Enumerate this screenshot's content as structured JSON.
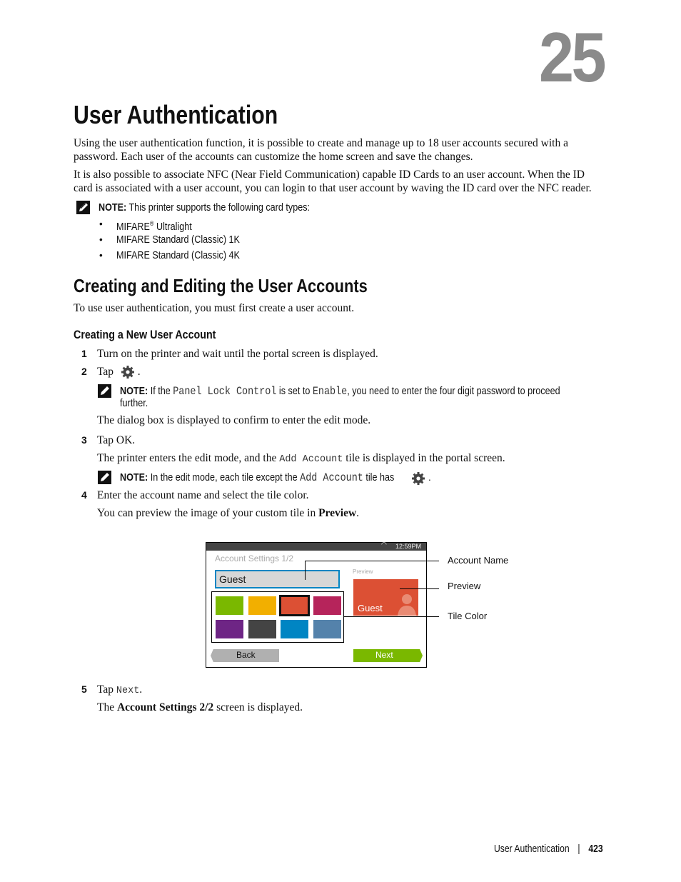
{
  "chapter_number": "25",
  "title": "User Authentication",
  "intro": {
    "p1": [
      "Using the user authentication function, it is possible to create and manage up to 18 user accounts secured with a",
      "password. Each user of the accounts can customize the home screen and save the changes."
    ],
    "p2": [
      "It is also possible to associate NFC (Near Field Communication) capable ID Cards to an user account. When the ID",
      "card is associated with a user account, you can login to that user account by waving the ID card over the NFC reader."
    ]
  },
  "note1": {
    "label": "NOTE:",
    "text": "This printer supports the following card types:",
    "items": [
      {
        "text": "MIFARE",
        "sup": "®",
        "rest": " Ultralight"
      },
      {
        "text": "MIFARE Standard (Classic) 1K"
      },
      {
        "text": "MIFARE Standard (Classic) 4K"
      }
    ]
  },
  "section": {
    "title": "Creating and Editing the User Accounts",
    "intro": "To use user authentication, you must first create a user account."
  },
  "subsection": {
    "title": "Creating a New User Account"
  },
  "steps": [
    {
      "num": "1",
      "text": "Turn on the printer and wait until the portal screen is displayed."
    },
    {
      "num": "2",
      "text": "Tap",
      "after": ".",
      "icon": "gear-icon",
      "note": {
        "label": "NOTE:",
        "pre": "If the",
        "code1": "Panel Lock Control",
        "mid": "is set to",
        "code2": "Enable",
        "post": ", you need to enter the four digit password to proceed",
        "line2": "further."
      },
      "follow": "The dialog box is displayed to confirm to enter the edit mode."
    },
    {
      "num": "3",
      "text": "Tap",
      "bold": "OK",
      "after": ".",
      "follow_pre": "The printer enters the edit mode, and the",
      "follow_code": "Add Account",
      "follow_post": "tile is displayed in the portal screen.",
      "note": {
        "label": "NOTE:",
        "pre": "In the edit mode, each tile except the",
        "code": "Add Account",
        "post": "tile has",
        "after": "."
      }
    },
    {
      "num": "4",
      "text": "Enter the account name and select the tile color.",
      "follow_pre": "You can preview the image of your custom tile in",
      "follow_bold": "Preview",
      "follow_post": "."
    },
    {
      "num": "5",
      "text": "Tap",
      "code": "Next",
      "after": ".",
      "follow_pre": "The",
      "follow_bold": "Account Settings 2/2",
      "follow_post": "screen is displayed."
    }
  ],
  "figure": {
    "time": "12:59PM",
    "screen_title": "Account Settings 1/2",
    "name_value": "Guest",
    "preview_label": "Preview",
    "preview_name": "Guest",
    "colors": [
      "#7ab800",
      "#f2af00",
      "#dc5034",
      "#b6245b",
      "#6e2585",
      "#444444",
      "#0085c3",
      "#5482ab"
    ],
    "selected_color_index": 2,
    "back": "Back",
    "next": "Next",
    "callouts": [
      "Account Name",
      "Preview",
      "Tile Color"
    ]
  },
  "footer": {
    "section": "User Authentication",
    "separator": "|",
    "page": "423"
  }
}
